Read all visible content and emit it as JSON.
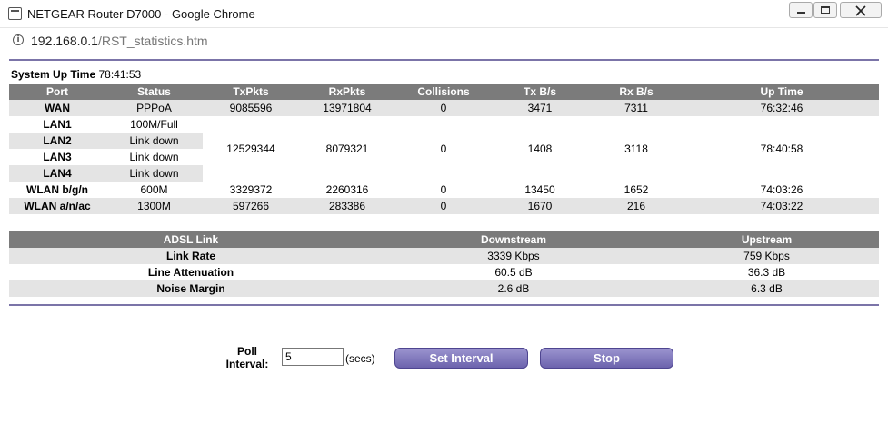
{
  "window": {
    "title": "NETGEAR Router D7000 - Google Chrome"
  },
  "address": {
    "host": "192.168.0.1",
    "path": "/RST_statistics.htm"
  },
  "uptime": {
    "label": "System Up Time",
    "value": "78:41:53"
  },
  "ports": {
    "headers": [
      "Port",
      "Status",
      "TxPkts",
      "RxPkts",
      "Collisions",
      "Tx B/s",
      "Rx B/s",
      "Up Time"
    ],
    "wan": {
      "port": "WAN",
      "status": "PPPoA",
      "tx": "9085596",
      "rx": "13971804",
      "col": "0",
      "txbs": "3471",
      "rxbs": "7311",
      "up": "76:32:46"
    },
    "lan": {
      "ports": [
        {
          "port": "LAN1",
          "status": "100M/Full"
        },
        {
          "port": "LAN2",
          "status": "Link down"
        },
        {
          "port": "LAN3",
          "status": "Link down"
        },
        {
          "port": "LAN4",
          "status": "Link down"
        }
      ],
      "tx": "12529344",
      "rx": "8079321",
      "col": "0",
      "txbs": "1408",
      "rxbs": "3118",
      "up": "78:40:58"
    },
    "wlan_bgn": {
      "port": "WLAN b/g/n",
      "status": "600M",
      "tx": "3329372",
      "rx": "2260316",
      "col": "0",
      "txbs": "13450",
      "rxbs": "1652",
      "up": "74:03:26"
    },
    "wlan_ac": {
      "port": "WLAN a/n/ac",
      "status": "1300M",
      "tx": "597266",
      "rx": "283386",
      "col": "0",
      "txbs": "1670",
      "rxbs": "216",
      "up": "74:03:22"
    }
  },
  "adsl": {
    "headers": [
      "ADSL Link",
      "Downstream",
      "Upstream"
    ],
    "rows": [
      {
        "label": "Link Rate",
        "down": "3339 Kbps",
        "up": "759 Kbps"
      },
      {
        "label": "Line Attenuation",
        "down": "60.5 dB",
        "up": "36.3 dB"
      },
      {
        "label": "Noise Margin",
        "down": "2.6 dB",
        "up": "6.3 dB"
      }
    ]
  },
  "poll": {
    "label_line1": "Poll",
    "label_line2": "Interval:",
    "value": "5",
    "unit": "(secs)"
  },
  "buttons": {
    "set_interval": "Set Interval",
    "stop": "Stop"
  }
}
